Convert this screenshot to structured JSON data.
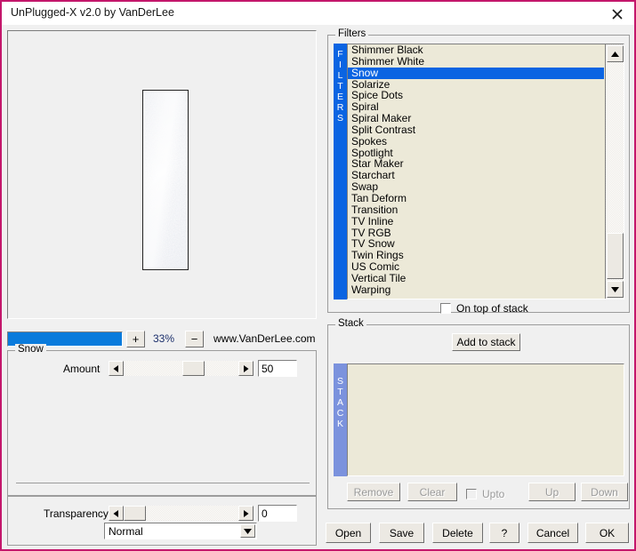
{
  "window": {
    "title": "UnPlugged-X v2.0 by VanDerLee",
    "close_icon": "close-icon",
    "border_color": "#c3176b"
  },
  "preview": {
    "zoom_bar_fill_percent": 100,
    "zoom_in_label": "+",
    "zoom_value": "33%",
    "zoom_out_label": "−",
    "site_link": "www.VanDerLee.com"
  },
  "snow": {
    "group_label": "Snow",
    "amount_label": "Amount",
    "amount_value": "50",
    "amount_slider_percent": 50,
    "left_arrow": "◄",
    "right_arrow": "►"
  },
  "transparency": {
    "label": "Transparency",
    "value": "0",
    "slider_percent": 0,
    "left_arrow": "◄",
    "right_arrow": "►",
    "blend_mode": "Normal",
    "dropdown_arrow": "▼"
  },
  "filters": {
    "group_label": "Filters",
    "strip_label": "FILTERS",
    "selected": "Snow",
    "items": [
      "Shimmer Black",
      "Shimmer White",
      "Snow",
      "Solarize",
      "Spice Dots",
      "Spiral",
      "Spiral Maker",
      "Split Contrast",
      "Spokes",
      "Spotlight",
      "Star Maker",
      "Starchart",
      "Swap",
      "Tan Deform",
      "Transition",
      "TV Inline",
      "TV RGB",
      "TV Snow",
      "Twin Rings",
      "US Comic",
      "Vertical Tile",
      "Warping"
    ],
    "scroll_up_arrow": "▲",
    "scroll_down_arrow": "▼",
    "on_top_of_stack_label": "On top of stack",
    "on_top_of_stack_checked": false,
    "highlight_color": "#0a64e2",
    "list_background": "#ece9d8"
  },
  "stack": {
    "group_label": "Stack",
    "strip_label": "STACK",
    "add_to_stack_label": "Add to stack",
    "items": [],
    "remove_label": "Remove",
    "clear_label": "Clear",
    "upto_label": "Upto",
    "upto_checked": false,
    "up_label": "Up",
    "down_label": "Down",
    "strip_color": "#7b92dd"
  },
  "bottom_buttons": {
    "open": "Open",
    "save": "Save",
    "delete": "Delete",
    "help": "?",
    "cancel": "Cancel",
    "ok": "OK"
  }
}
